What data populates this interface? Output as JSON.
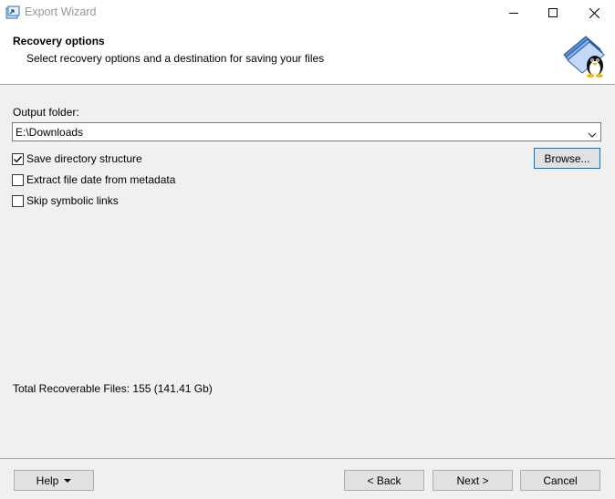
{
  "window": {
    "title": "Export Wizard"
  },
  "header": {
    "title": "Recovery options",
    "subtitle": "Select recovery options and a destination for saving your files"
  },
  "output": {
    "label": "Output folder:",
    "value": "E:\\Downloads"
  },
  "options": [
    {
      "label": "Save directory structure",
      "checked": true
    },
    {
      "label": "Extract file date from metadata",
      "checked": false
    },
    {
      "label": "Skip symbolic links",
      "checked": false
    }
  ],
  "browse_label": "Browse...",
  "total_label": "Total Recoverable Files: 155 (141.41 Gb)",
  "footer": {
    "help_label": "Help",
    "back_label": "< Back",
    "next_label": "Next >",
    "cancel_label": "Cancel"
  }
}
